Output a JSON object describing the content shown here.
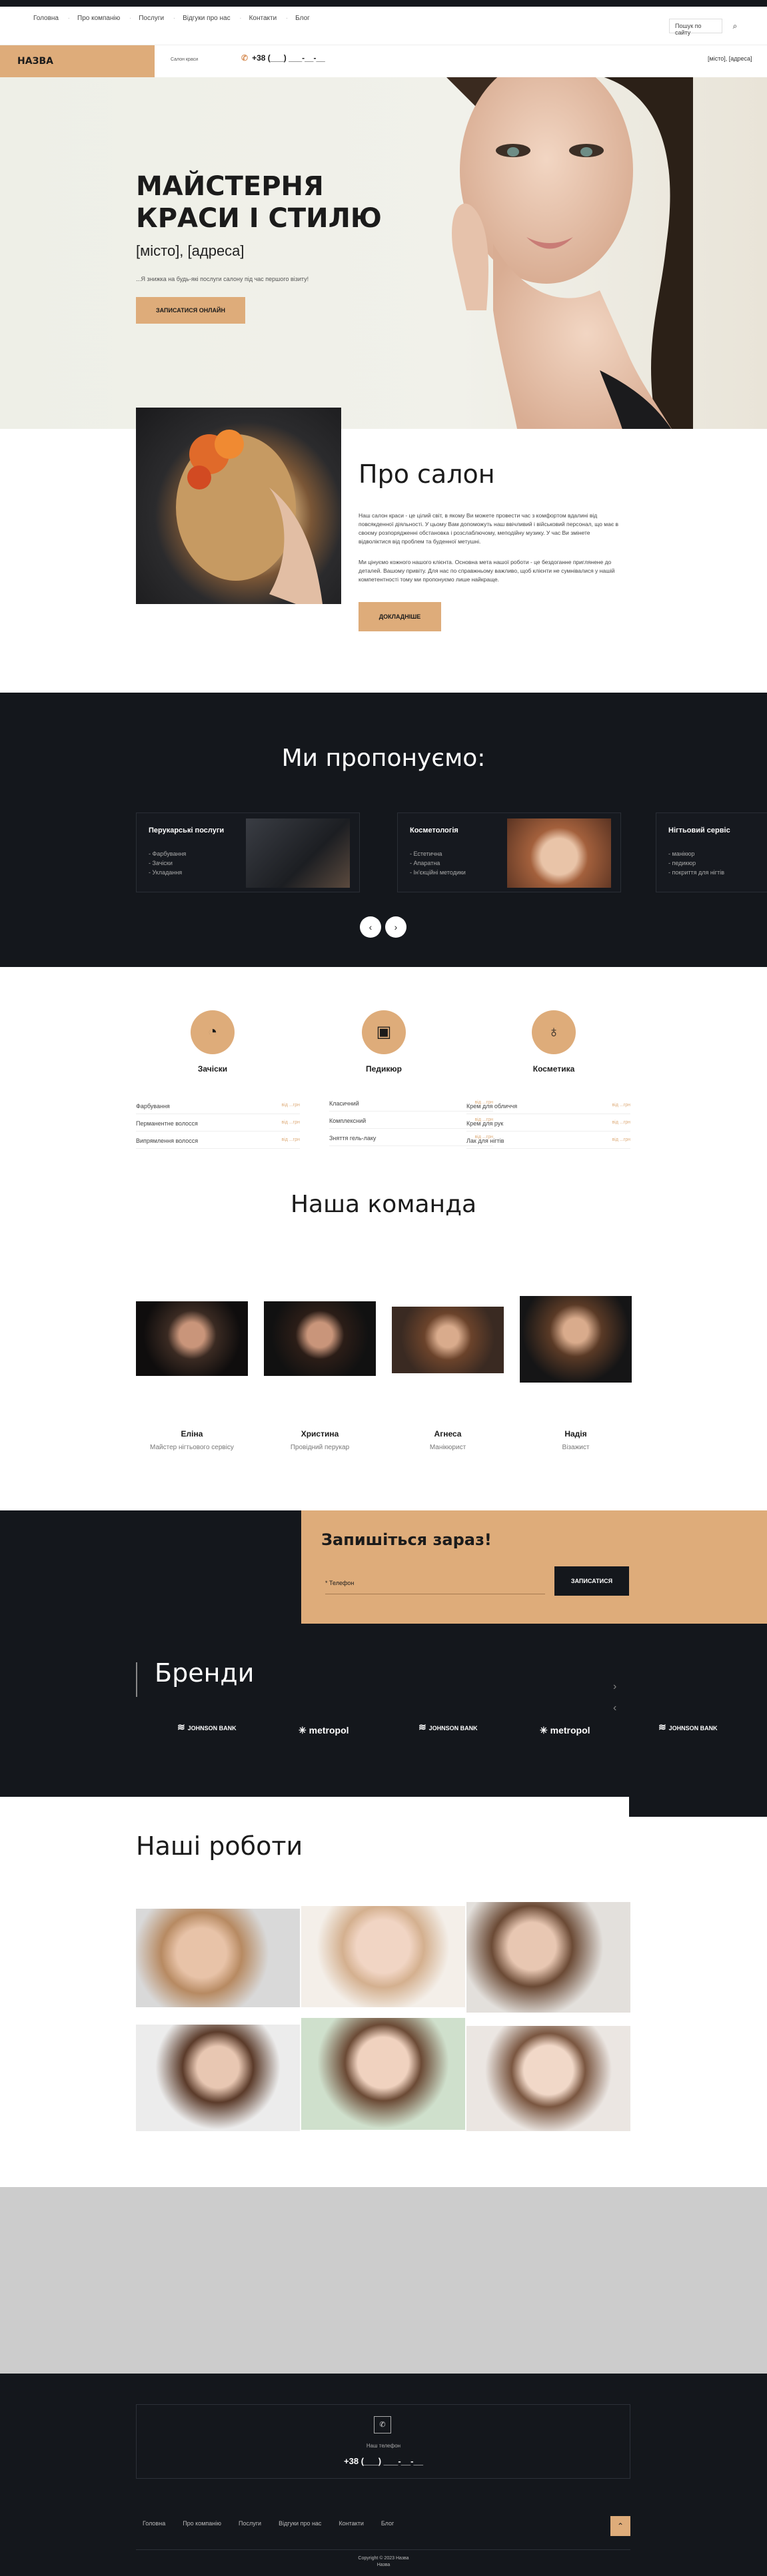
{
  "nav": {
    "links": [
      "Головна",
      "Про компанію",
      "Послуги",
      "Відгуки про нас",
      "Контакти",
      "Блог"
    ],
    "search_placeholder": "Пошук по сайту",
    "logo": "НАЗВА",
    "tagline": "Салон краси",
    "phone": "+38 (___) ___-__-__",
    "city_address": "[місто], [адреса]"
  },
  "hero": {
    "title": "МАЙСТЕРНЯ КРАСИ І СТИЛЮ",
    "address": "[місто], [адреса]",
    "subtitle": "...Я знижка на будь-які послуги салону під час першого візиту!",
    "button": "ЗАПИСАТИСЯ ОНЛАЙН"
  },
  "about": {
    "title": "Про салон",
    "p1": "Наш салон краси - це цілий світ, в якому Ви можете провести час з комфортом вдалині від повсякденної діяльності. У цьому Вам допоможуть наш ввічливий і військовий персонал, що має в своєму розпорядженні обстановка і розслаблючому, меподійну музику. У час Ви змінете відволіктися від проблем та буденної метушні.",
    "p2": "Ми цінуємо кожного нашого клієнта. Основна мета нашої роботи - це бездоганне приглянене до деталей. Вашому привіту. Для нас по справжньому важливо, щоб клієнти не сумнівалися у нашій компетентності тому ми пропонуємо лише найкраще.",
    "button": "ДОКЛАДНІШЕ"
  },
  "offer": {
    "title": "Ми пропонуємо:",
    "cards": [
      {
        "title": "Перукарські послуги",
        "items": [
          "- Фарбування",
          "- Зачіски",
          "- Укладання"
        ]
      },
      {
        "title": "Косметологія",
        "items": [
          "- Естетична",
          "- Апаратна",
          "- Ін'єкційні методики"
        ]
      },
      {
        "title": "Нігтьовий сервіс",
        "items": [
          "- манікюр",
          "- педикюр",
          "- покриття для нігтів"
        ]
      }
    ],
    "prev": "‹",
    "next": "›"
  },
  "services": [
    {
      "title": "Зачіски",
      "icon": "hair-icon",
      "prices": [
        [
          "Фарбування",
          "від ...грн"
        ],
        [
          "Перманентне волосся",
          "від ...грн"
        ],
        [
          "Випрямлення волосся",
          "від ...грн"
        ]
      ]
    },
    {
      "title": "Педикюр",
      "icon": "pedicure-icon",
      "prices": [
        [
          "Класичний",
          "від ...грн"
        ],
        [
          "Комплексний",
          "від ...грн"
        ],
        [
          "Зняття гель-лаку",
          "від ...грн"
        ]
      ]
    },
    {
      "title": "Косметика",
      "icon": "cosmetics-icon",
      "prices": [
        [
          "Крем для обличчя",
          "від ...грн"
        ],
        [
          "Крем для рук",
          "від ...грн"
        ],
        [
          "Лак для нігтів",
          "від ...грн"
        ]
      ]
    }
  ],
  "team": {
    "title": "Наша команда",
    "members": [
      {
        "name": "Еліна",
        "role": "Майстер нігтьового сервісу"
      },
      {
        "name": "Христина",
        "role": "Провідний перукар"
      },
      {
        "name": "Агнеса",
        "role": "Манікюрист"
      },
      {
        "name": "Надія",
        "role": "Візажист"
      }
    ]
  },
  "signup": {
    "title": "Запишіться зараз!",
    "placeholder": "* Телефон",
    "button": "ЗАПИСАТИСЯ"
  },
  "brands": {
    "title": "Бренди",
    "logos": [
      "JOHNSON BANK",
      "metropol",
      "JOHNSON BANK",
      "metropol",
      "JOHNSON BANK"
    ]
  },
  "works": {
    "title": "Наші роботи"
  },
  "footer": {
    "label": "Наш телефон",
    "phone": "+38 (___) ___-__-__",
    "links": [
      "Головна",
      "Про компанію",
      "Послуги",
      "Відгуки про нас",
      "Контакти",
      "Блог"
    ],
    "copyright": "Copyright © 2023 Назва",
    "copyright2": "Назва"
  },
  "colors": {
    "accent": "#deac7a",
    "dark": "#14171c"
  }
}
